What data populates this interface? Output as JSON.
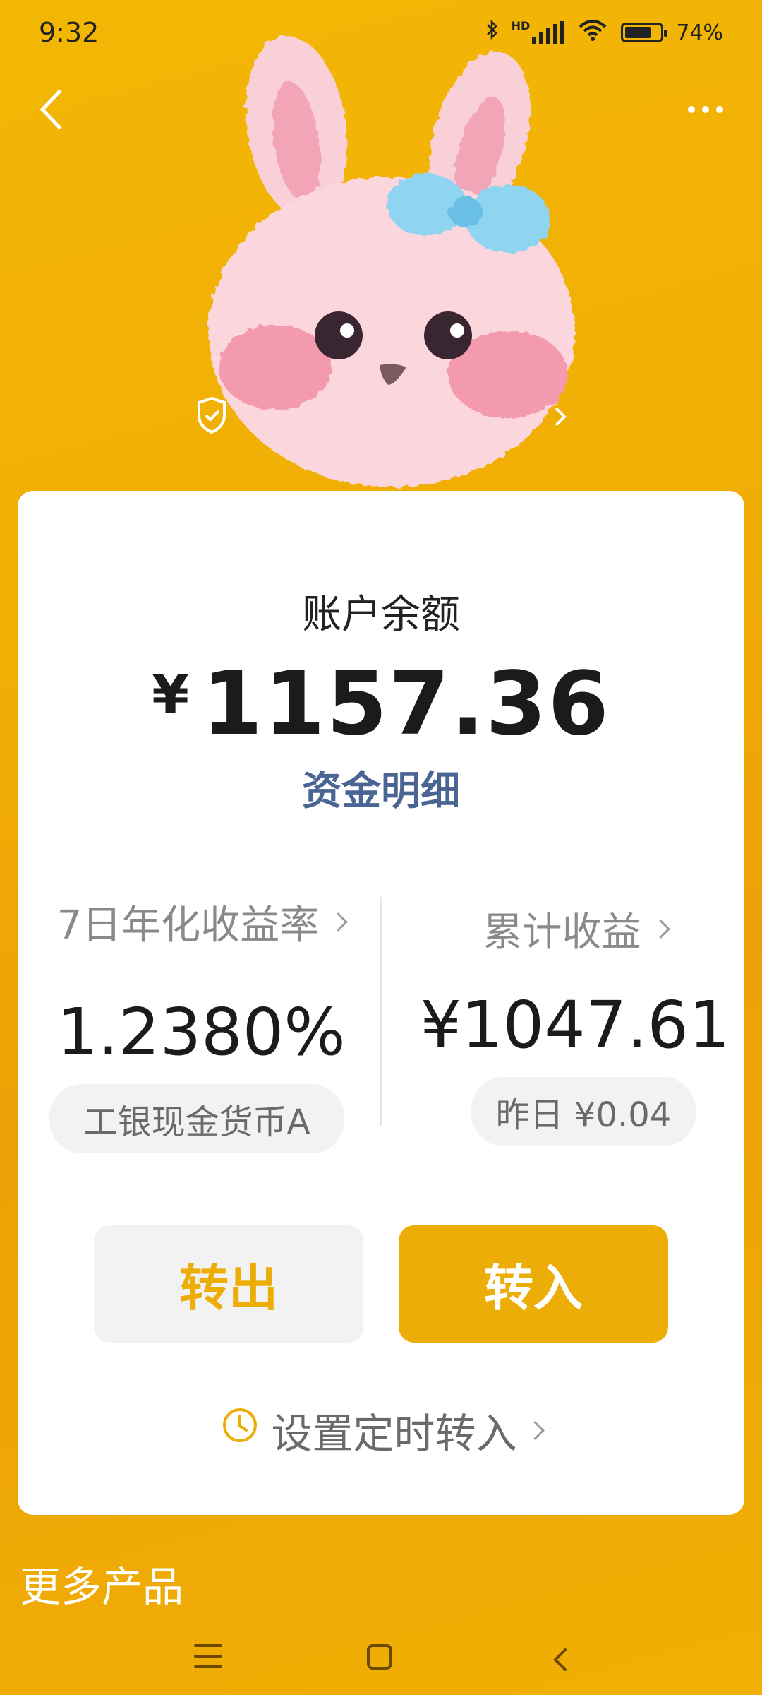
{
  "status_bar": {
    "time": "9:32",
    "network_label": "HD",
    "battery_percent": "74%",
    "battery_level": 0.74
  },
  "header": {
    "back_icon": "chevron-left-icon",
    "more_icon": "more-horizontal-icon"
  },
  "avatar": {
    "description_icon": "bunny-avatar"
  },
  "card": {
    "title": "账户余额",
    "currency": "¥",
    "balance": "1157.36",
    "detail_link": "资金明细",
    "left_column": {
      "label": "7日年化收益率",
      "value": "1.2380%",
      "fund_name": "工银现金货币A"
    },
    "right_column": {
      "label": "累计收益",
      "value": "¥1047.61",
      "yesterday": "昨日 ¥0.04"
    },
    "buttons": {
      "transfer_out": "转出",
      "transfer_in": "转入"
    },
    "timer_link": "设置定时转入"
  },
  "section": {
    "more_products": "更多产品"
  },
  "colors": {
    "background": "#F2B705",
    "accent": "#EDAD07",
    "link": "#4A6494"
  }
}
